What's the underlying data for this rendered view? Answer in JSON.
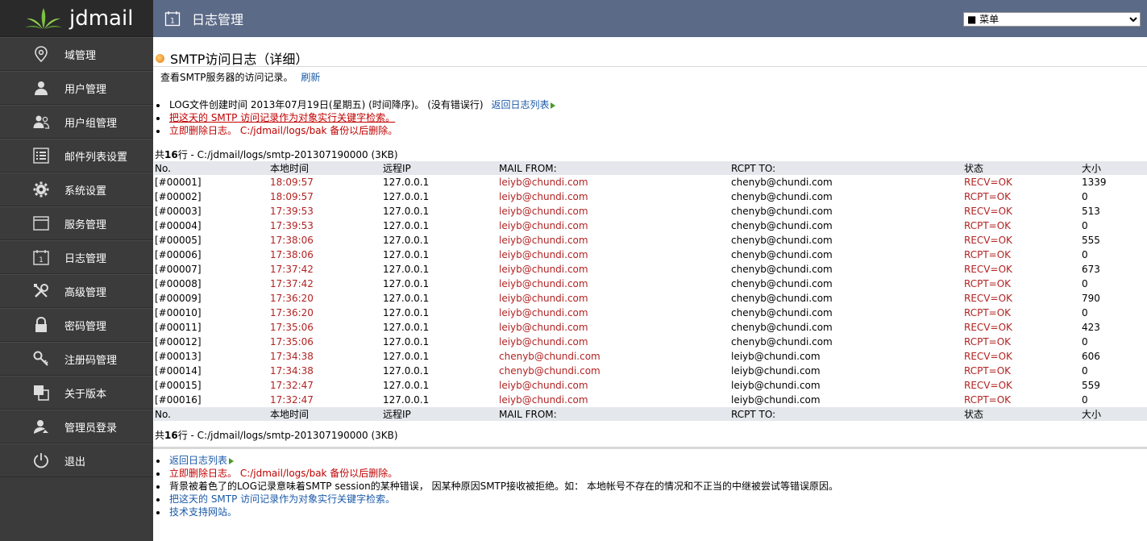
{
  "app": {
    "brand": "jdmail"
  },
  "sidebar": {
    "items": [
      {
        "label": "域管理",
        "icon": "location-pin-icon"
      },
      {
        "label": "用户管理",
        "icon": "user-icon"
      },
      {
        "label": "用户组管理",
        "icon": "users-group-icon"
      },
      {
        "label": "邮件列表设置",
        "icon": "list-icon"
      },
      {
        "label": "系统设置",
        "icon": "gear-icon"
      },
      {
        "label": "服务管理",
        "icon": "window-icon"
      },
      {
        "label": "日志管理",
        "icon": "calendar-icon"
      },
      {
        "label": "高级管理",
        "icon": "tools-icon"
      },
      {
        "label": "密码管理",
        "icon": "lock-icon"
      },
      {
        "label": "注册码管理",
        "icon": "key-icon"
      },
      {
        "label": "关于版本",
        "icon": "copy-icon"
      },
      {
        "label": "管理员登录",
        "icon": "admin-user-icon"
      },
      {
        "label": "退出",
        "icon": "power-icon"
      }
    ]
  },
  "header": {
    "title": "日志管理",
    "icon": "calendar-icon",
    "menu_select": "■ 菜单"
  },
  "page": {
    "title": "SMTP访问日志（详细）",
    "intro_text": "查看SMTP服务器的访问记录。",
    "refresh_label": "刷新",
    "top_list": {
      "line1_text": "LOG文件创建时间 2013年07月19日(星期五) (时间降序)。 (没有错误行)",
      "line1_link": "返回日志列表",
      "line2": "把这天的 SMTP 访问记录作为对象实行关键字检索。",
      "line3": "立即删除日志。   C:/jdmail/logs/bak 备份以后删除。"
    },
    "summary_prefix": "共",
    "summary_count": "16",
    "summary_suffix": "行 - C:/jdmail/logs/smtp-201307190000 (3KB)"
  },
  "table": {
    "columns": [
      "No.",
      "本地时间",
      "远程IP",
      "MAIL FROM:",
      "RCPT TO:",
      "状态",
      "大小"
    ],
    "rows": [
      [
        "[#00001]",
        "18:09:57",
        "127.0.0.1",
        "leiyb@chundi.com",
        "chenyb@chundi.com",
        "RECV=OK",
        "1339"
      ],
      [
        "[#00002]",
        "18:09:57",
        "127.0.0.1",
        "leiyb@chundi.com",
        "chenyb@chundi.com",
        "RCPT=OK",
        "0"
      ],
      [
        "[#00003]",
        "17:39:53",
        "127.0.0.1",
        "leiyb@chundi.com",
        "chenyb@chundi.com",
        "RECV=OK",
        "513"
      ],
      [
        "[#00004]",
        "17:39:53",
        "127.0.0.1",
        "leiyb@chundi.com",
        "chenyb@chundi.com",
        "RCPT=OK",
        "0"
      ],
      [
        "[#00005]",
        "17:38:06",
        "127.0.0.1",
        "leiyb@chundi.com",
        "chenyb@chundi.com",
        "RECV=OK",
        "555"
      ],
      [
        "[#00006]",
        "17:38:06",
        "127.0.0.1",
        "leiyb@chundi.com",
        "chenyb@chundi.com",
        "RCPT=OK",
        "0"
      ],
      [
        "[#00007]",
        "17:37:42",
        "127.0.0.1",
        "leiyb@chundi.com",
        "chenyb@chundi.com",
        "RECV=OK",
        "673"
      ],
      [
        "[#00008]",
        "17:37:42",
        "127.0.0.1",
        "leiyb@chundi.com",
        "chenyb@chundi.com",
        "RCPT=OK",
        "0"
      ],
      [
        "[#00009]",
        "17:36:20",
        "127.0.0.1",
        "leiyb@chundi.com",
        "chenyb@chundi.com",
        "RECV=OK",
        "790"
      ],
      [
        "[#00010]",
        "17:36:20",
        "127.0.0.1",
        "leiyb@chundi.com",
        "chenyb@chundi.com",
        "RCPT=OK",
        "0"
      ],
      [
        "[#00011]",
        "17:35:06",
        "127.0.0.1",
        "leiyb@chundi.com",
        "chenyb@chundi.com",
        "RECV=OK",
        "423"
      ],
      [
        "[#00012]",
        "17:35:06",
        "127.0.0.1",
        "leiyb@chundi.com",
        "chenyb@chundi.com",
        "RCPT=OK",
        "0"
      ],
      [
        "[#00013]",
        "17:34:38",
        "127.0.0.1",
        "chenyb@chundi.com",
        "leiyb@chundi.com",
        "RECV=OK",
        "606"
      ],
      [
        "[#00014]",
        "17:34:38",
        "127.0.0.1",
        "chenyb@chundi.com",
        "leiyb@chundi.com",
        "RCPT=OK",
        "0"
      ],
      [
        "[#00015]",
        "17:32:47",
        "127.0.0.1",
        "leiyb@chundi.com",
        "leiyb@chundi.com",
        "RECV=OK",
        "559"
      ],
      [
        "[#00016]",
        "17:32:47",
        "127.0.0.1",
        "leiyb@chundi.com",
        "leiyb@chundi.com",
        "RCPT=OK",
        "0"
      ]
    ]
  },
  "bottom_list": {
    "back_link": "返回日志列表",
    "delete": "立即删除日志。   C:/jdmail/logs/bak 备份以后删除。",
    "note": "背景被着色了的LOG记录意味着SMTP session的某种错误， 因某种原因SMTP接收被拒绝。如： 本地帐号不存在的情况和不正当的中继被尝试等错误原因。",
    "search": "把这天的 SMTP 访问记录作为对象实行关键字检索。",
    "support": "技术支持网站。"
  },
  "colors": {
    "sidebar_bg": "#3b3b3b",
    "header_bg": "#5b6a87",
    "link": "#1a5aa8",
    "accent_red": "#c00000"
  }
}
